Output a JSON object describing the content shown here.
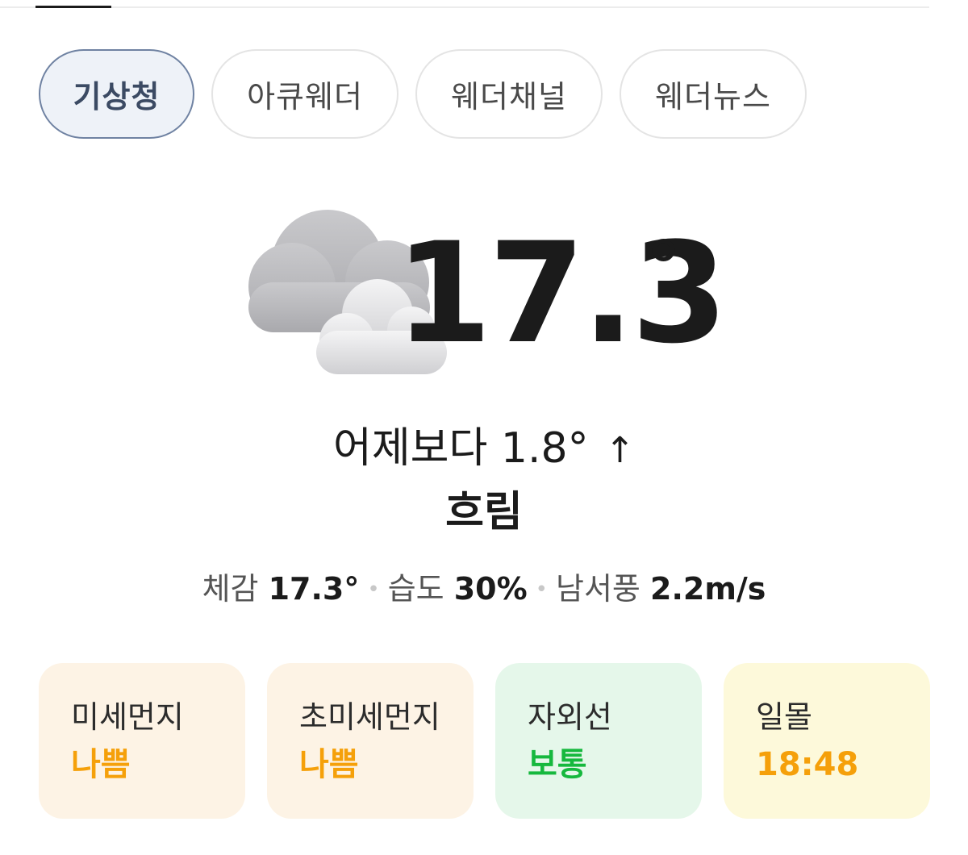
{
  "tabs": [
    {
      "label": "기상청",
      "active": true
    },
    {
      "label": "아큐웨더",
      "active": false
    },
    {
      "label": "웨더채널",
      "active": false
    },
    {
      "label": "웨더뉴스",
      "active": false
    }
  ],
  "current": {
    "icon": "cloudy-icon",
    "temperature": "17.3",
    "degree_symbol": "°",
    "compare_text": "어제보다 1.8°",
    "compare_arrow": "↑",
    "condition": "흐림"
  },
  "details": {
    "feels_label": "체감",
    "feels_value": "17.3°",
    "humidity_label": "습도",
    "humidity_value": "30%",
    "wind_label": "남서풍",
    "wind_value": "2.2m/s",
    "separator": "•"
  },
  "cards": [
    {
      "label": "미세먼지",
      "value": "나쁨",
      "bg": "#fdf3e5",
      "value_color": "#f5a00a"
    },
    {
      "label": "초미세먼지",
      "value": "나쁨",
      "bg": "#fdf3e5",
      "value_color": "#f5a00a"
    },
    {
      "label": "자외선",
      "value": "보통",
      "bg": "#e5f7ea",
      "value_color": "#16b83e"
    },
    {
      "label": "일몰",
      "value": "18:48",
      "bg": "#fdf9da",
      "value_color": "#f5a00a"
    }
  ]
}
